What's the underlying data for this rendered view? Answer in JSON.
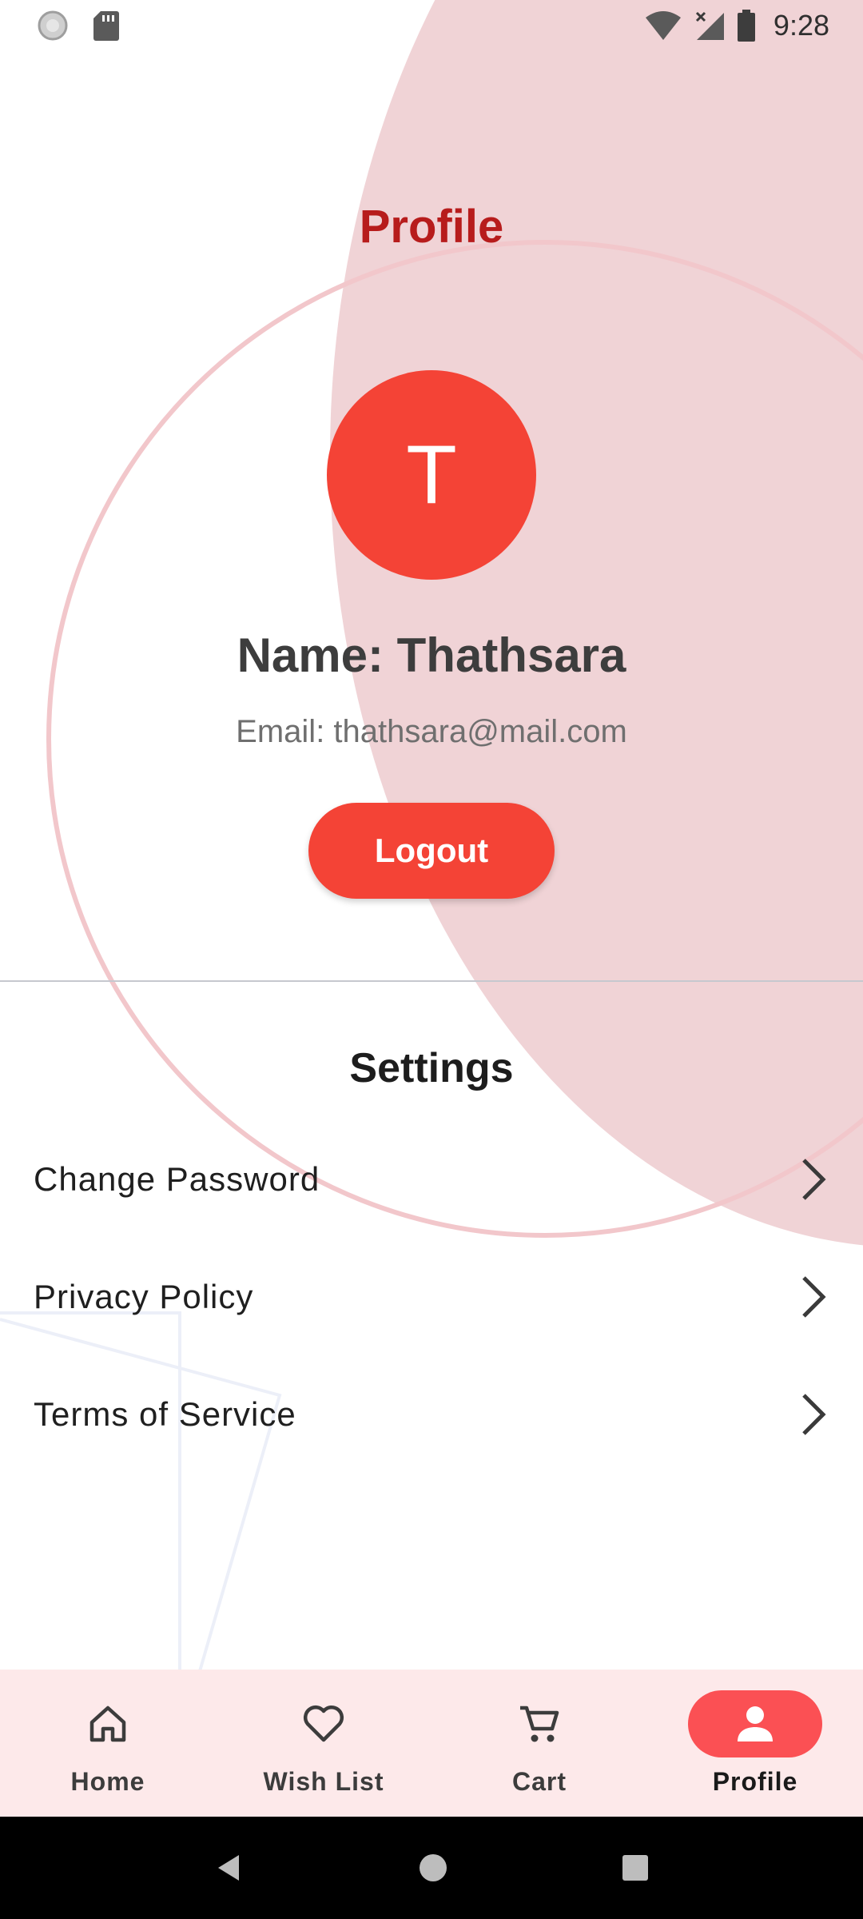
{
  "status_bar": {
    "time": "9:28",
    "icons": [
      "sync-icon",
      "sd-card-icon",
      "wifi-icon",
      "signal-no-service-icon",
      "battery-icon"
    ]
  },
  "header": {
    "title": "Profile"
  },
  "profile": {
    "avatar_initial": "T",
    "name": "Name: Thathsara",
    "email": "Email: thathsara@mail.com",
    "logout_label": "Logout"
  },
  "settings": {
    "title": "Settings",
    "items": [
      {
        "label": "Change Password",
        "icon": "chevron-right-icon"
      },
      {
        "label": "Privacy Policy",
        "icon": "chevron-right-icon"
      },
      {
        "label": "Terms of Service",
        "icon": "chevron-right-icon"
      }
    ]
  },
  "bottom_nav": {
    "items": [
      {
        "label": "Home",
        "icon": "home-icon",
        "active": false
      },
      {
        "label": "Wish List",
        "icon": "heart-icon",
        "active": false
      },
      {
        "label": "Cart",
        "icon": "cart-icon",
        "active": false
      },
      {
        "label": "Profile",
        "icon": "person-icon",
        "active": true
      }
    ]
  },
  "system_nav": {
    "icons": [
      "back-icon",
      "home-circle-icon",
      "recents-icon"
    ]
  },
  "colors": {
    "accent": "#f44336",
    "title": "#b71c1c",
    "nav_background": "#fde9ea",
    "nav_active": "#fb5054",
    "decor_circle": "#f0d3d6"
  }
}
